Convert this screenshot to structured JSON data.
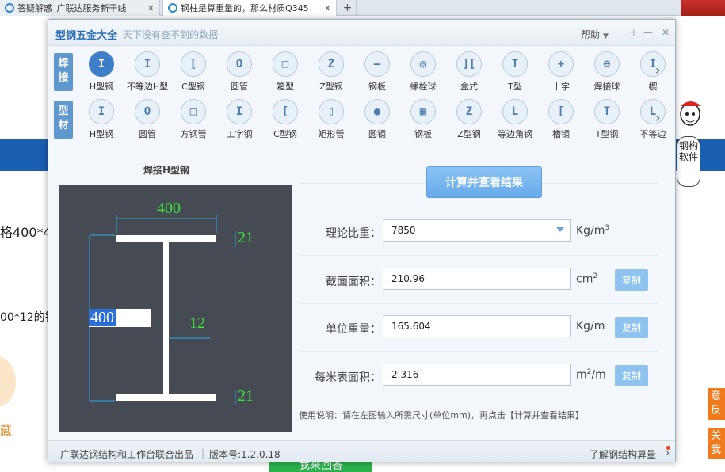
{
  "browser": {
    "tab1_title": "答疑解惑_广联达服务新干线",
    "tab2_title": "钢柱是算重量的，那么材质Q345",
    "tab_close": "✕",
    "new_tab": "+"
  },
  "background": {
    "spec_text": "格400*4",
    "spec_text2": "00*12的钢",
    "link_text": "藏",
    "orange_btn1": "意反",
    "orange_btn2": "关我",
    "answer_btn": "我来回答",
    "mascot_label": "钢构软件"
  },
  "app": {
    "title": "型钢五金大全",
    "subtitle": "天下没有查不到的数据",
    "help_label": "帮助",
    "window_buttons": [
      "pin-icon",
      "minimize-icon",
      "close-icon"
    ]
  },
  "categories": {
    "row1_label": "焊接",
    "row1_items": [
      {
        "label": "H型钢",
        "glyph": "I",
        "active": true
      },
      {
        "label": "不等边H型",
        "glyph": "I"
      },
      {
        "label": "C型钢",
        "glyph": "[",
        "active": false
      },
      {
        "label": "圆管",
        "glyph": "O"
      },
      {
        "label": "箱型",
        "glyph": "□"
      },
      {
        "label": "Z型钢",
        "glyph": "Z"
      },
      {
        "label": "钢板",
        "glyph": "—"
      },
      {
        "label": "螺栓球",
        "glyph": "◎"
      },
      {
        "label": "盒式",
        "glyph": "]["
      },
      {
        "label": "T型",
        "glyph": "T"
      },
      {
        "label": "十字",
        "glyph": "+"
      },
      {
        "label": "焊接球",
        "glyph": "⊖"
      },
      {
        "label": "楔",
        "glyph": "I"
      }
    ],
    "row2_label": "型材",
    "row2_items": [
      {
        "label": "H型钢",
        "glyph": "I"
      },
      {
        "label": "圆管",
        "glyph": "O"
      },
      {
        "label": "方钢管",
        "glyph": "□"
      },
      {
        "label": "工字钢",
        "glyph": "I"
      },
      {
        "label": "C型钢",
        "glyph": "["
      },
      {
        "label": "矩形管",
        "glyph": "▯"
      },
      {
        "label": "圆钢",
        "glyph": "●"
      },
      {
        "label": "钢板",
        "glyph": "▦"
      },
      {
        "label": "Z型钢",
        "glyph": "Z"
      },
      {
        "label": "等边角钢",
        "glyph": "L"
      },
      {
        "label": "槽钢",
        "glyph": "["
      },
      {
        "label": "T型钢",
        "glyph": "T"
      },
      {
        "label": "不等边",
        "glyph": "L"
      }
    ],
    "scroll_arrow": "›"
  },
  "drawing": {
    "title": "焊接H型钢",
    "width_b": "400",
    "flange_top": "21",
    "height_h": "400",
    "web_t": "12",
    "flange_bottom": "21"
  },
  "calc": {
    "button": "计算并查看结果",
    "density_label": "理论比重：",
    "density_value": "7850",
    "density_unit": "Kg/m",
    "density_unit_sup": "3",
    "area_label": "截面面积：",
    "area_value": "210.96",
    "area_unit": "cm",
    "area_unit_sup": "2",
    "weight_label": "单位重量：",
    "weight_value": "165.604",
    "weight_unit": "Kg/m",
    "surface_label": "每米表面积：",
    "surface_value": "2.316",
    "surface_unit_a": "m",
    "surface_unit_sup": "2",
    "surface_unit_b": "/m",
    "copy_label": "复制",
    "usage": "使用说明：请在左图输入所需尺寸(单位mm)，再点击【计算并查看结果】"
  },
  "footer": {
    "credit": "广联达钢结构和工作台联合出品",
    "version": "版本号:1.2.0.18",
    "learn": "了解钢结构算量",
    "learn_arrow": "›"
  }
}
